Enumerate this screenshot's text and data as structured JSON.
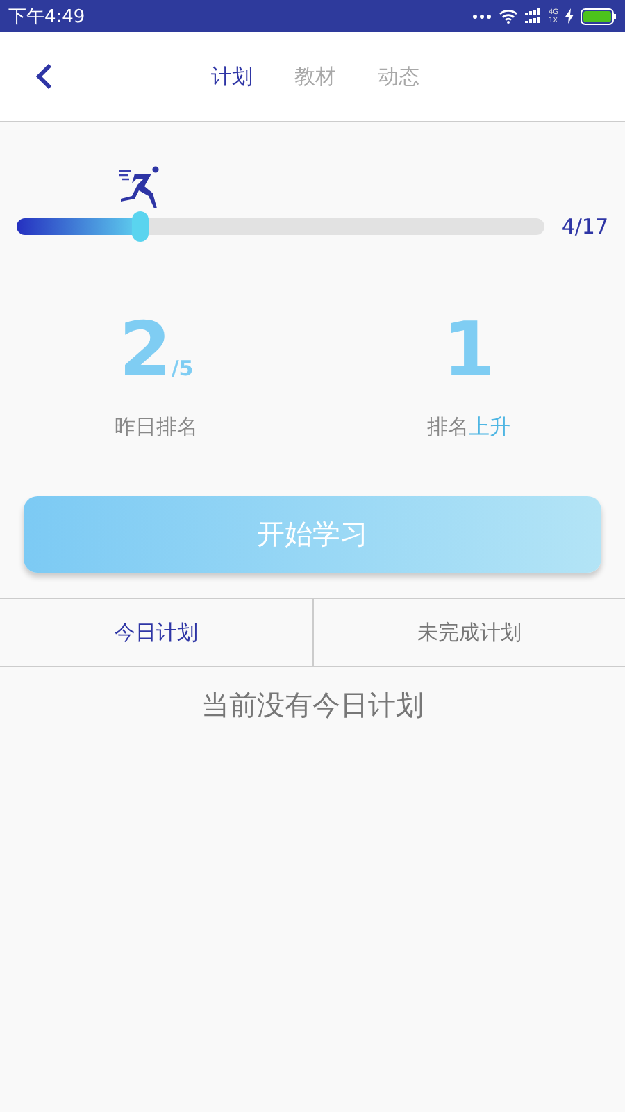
{
  "status_bar": {
    "time": "下午4:49",
    "network_top": "4G",
    "network_bottom": "1X"
  },
  "header": {
    "tabs": [
      {
        "label": "计划",
        "selected": true
      },
      {
        "label": "教材",
        "selected": false
      },
      {
        "label": "动态",
        "selected": false
      }
    ]
  },
  "progress": {
    "level": 0.235,
    "reading": "4/17"
  },
  "stats": [
    {
      "value": "2",
      "suffix": "/5",
      "label": "昨日排名"
    },
    {
      "value": "1",
      "label": "排名**上升**"
    }
  ],
  "start_button": "开始学习",
  "plan_tabs": [
    {
      "label": "今日计划",
      "selected": true
    },
    {
      "label": "未完成计划",
      "selected": false
    }
  ],
  "empty_message": "当前没有今日计划"
}
